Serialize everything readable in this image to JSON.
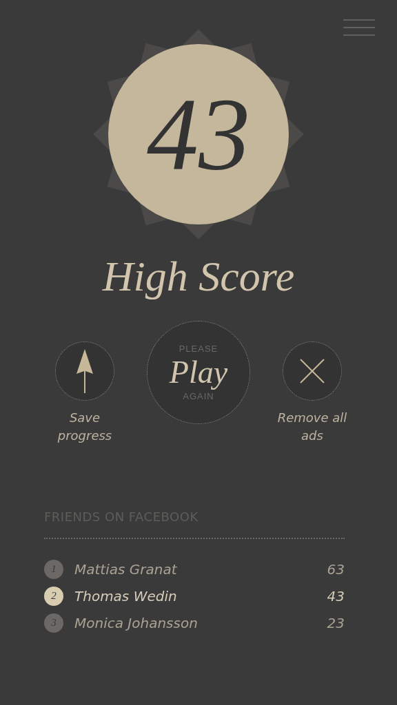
{
  "score": "43",
  "title": "High Score",
  "actions": [
    {
      "kind": "save",
      "label": "Save progress"
    },
    {
      "kind": "play",
      "top": "PLEASE",
      "label": "Play",
      "bottom": "AGAIN"
    },
    {
      "kind": "remove",
      "label": "Remove all ads"
    }
  ],
  "friends": {
    "heading": "FRIENDS ON FACEBOOK",
    "rows": [
      {
        "rank": "1",
        "name": "Mattias Granat",
        "score": "63",
        "selected": false
      },
      {
        "rank": "2",
        "name": "Thomas Wedin",
        "score": "43",
        "selected": true
      },
      {
        "rank": "3",
        "name": "Monica Johansson",
        "score": "23",
        "selected": false
      }
    ]
  }
}
